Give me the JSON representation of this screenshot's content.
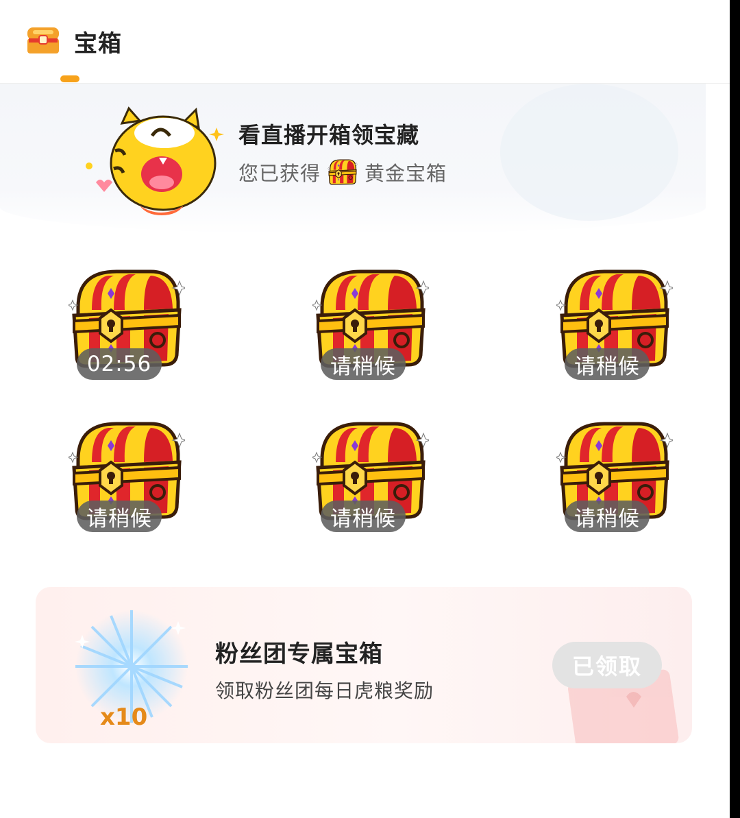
{
  "header": {
    "title": "宝箱",
    "icon": "treasure-chest-icon",
    "accent": "#f7a21b"
  },
  "banner": {
    "title": "看直播开箱领宝藏",
    "obtained_prefix": "您已获得",
    "obtained_item": "黄金宝箱",
    "mascot": "tiger-mascot"
  },
  "chests": [
    {
      "status": "02:56"
    },
    {
      "status": "请稍候"
    },
    {
      "status": "请稍候"
    },
    {
      "status": "请稍候"
    },
    {
      "status": "请稍候"
    },
    {
      "status": "请稍候"
    }
  ],
  "fan_club": {
    "title": "粉丝团专属宝箱",
    "description": "领取粉丝团每日虎粮奖励",
    "count": "x10",
    "button": "已领取",
    "icon": "sparkle-star-icon"
  }
}
